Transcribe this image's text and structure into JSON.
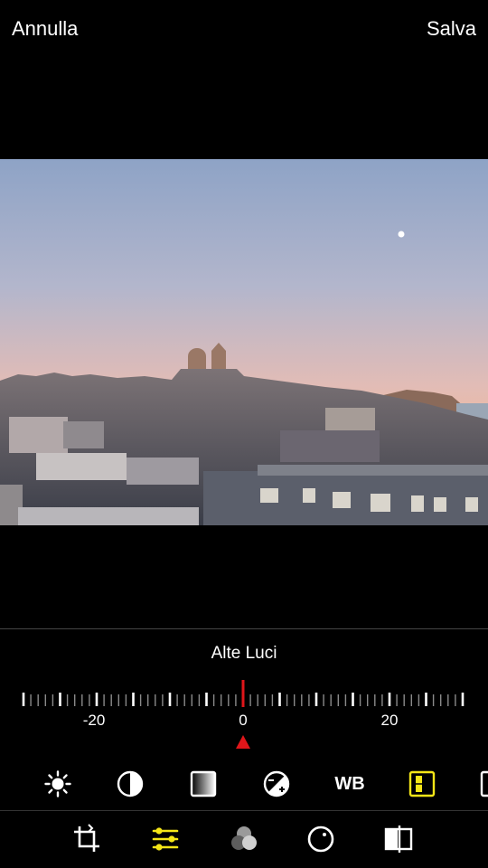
{
  "topbar": {
    "cancel_label": "Annulla",
    "save_label": "Salva"
  },
  "photo": {
    "subject": "city skyline at sunset with twin-towered church and moon"
  },
  "adjustment": {
    "label": "Alte Luci",
    "value": 0,
    "range": [
      -30,
      30
    ],
    "tick_labels": [
      "-20",
      "0",
      "20"
    ],
    "indicator_color": "#e0161a"
  },
  "tools": [
    {
      "icon": "brightness-icon"
    },
    {
      "icon": "contrast-icon"
    },
    {
      "icon": "saturation-icon"
    },
    {
      "icon": "exposure-icon"
    },
    {
      "icon": "white-balance-icon",
      "label": "WB"
    },
    {
      "icon": "highlights-icon",
      "selected": true
    },
    {
      "icon": "shadows-icon"
    }
  ],
  "tabs": [
    {
      "icon": "crop-icon"
    },
    {
      "icon": "adjust-sliders-icon",
      "selected": true
    },
    {
      "icon": "filters-icon"
    },
    {
      "icon": "vignette-icon"
    },
    {
      "icon": "compare-icon"
    }
  ],
  "colors": {
    "accent": "#f5e617",
    "indicator": "#e0161a",
    "background": "#000000"
  }
}
